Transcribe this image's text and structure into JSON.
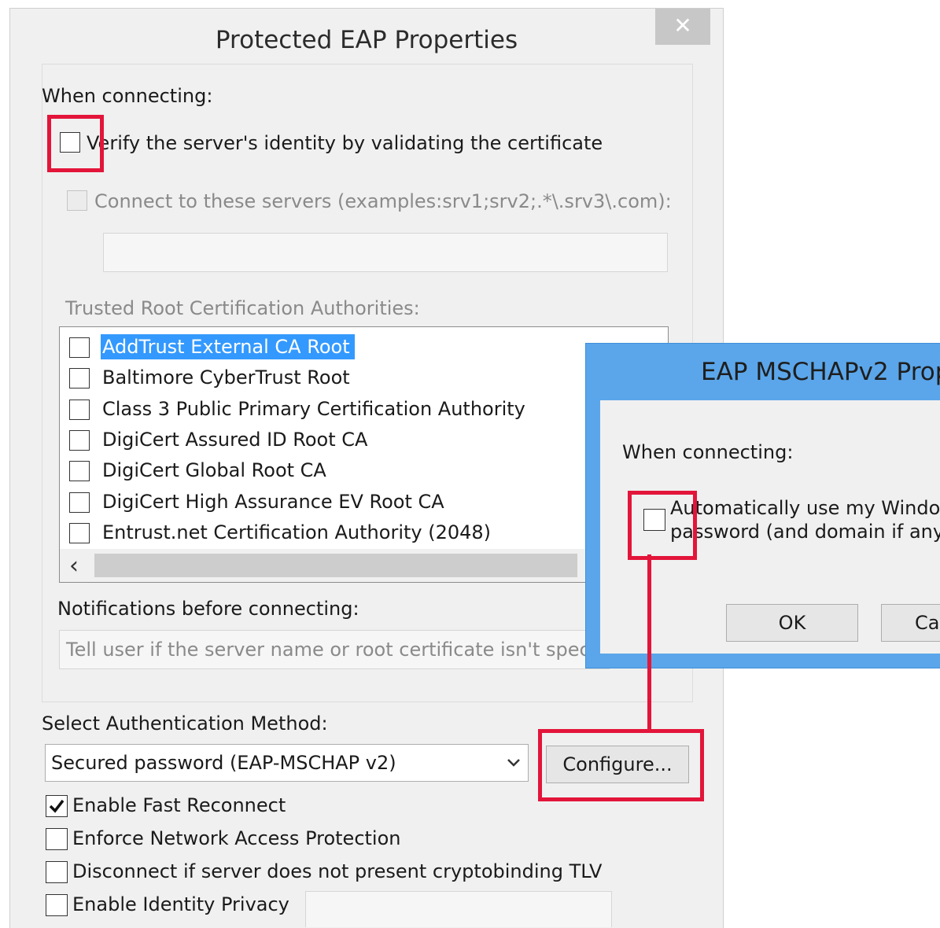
{
  "main_dialog": {
    "title": "Protected EAP Properties",
    "close_glyph": "✕",
    "when_connecting": "When connecting:",
    "verify_checkbox_label": "Verify the server's identity by validating the certificate",
    "verify_checked": false,
    "connect_servers_label": "Connect to these servers (examples:srv1;srv2;.*\\.srv3\\.com):",
    "connect_servers_value": "",
    "trusted_root_label": "Trusted Root Certification Authorities:",
    "trusted_roots": [
      {
        "label": "AddTrust External CA Root",
        "checked": false,
        "selected": true
      },
      {
        "label": "Baltimore CyberTrust Root",
        "checked": false,
        "selected": false
      },
      {
        "label": "Class 3 Public Primary Certification Authority",
        "checked": false,
        "selected": false
      },
      {
        "label": "DigiCert Assured ID Root CA",
        "checked": false,
        "selected": false
      },
      {
        "label": "DigiCert Global Root CA",
        "checked": false,
        "selected": false
      },
      {
        "label": "DigiCert High Assurance EV Root CA",
        "checked": false,
        "selected": false
      },
      {
        "label": "Entrust.net Certification Authority (2048)",
        "checked": false,
        "selected": false
      }
    ],
    "scroll_left_glyph": "‹",
    "notifications_label": "Notifications before connecting:",
    "notifications_value": "Tell user if the server name or root certificate isn't specified",
    "auth_method_label": "Select Authentication Method:",
    "auth_method_value": "Secured password (EAP-MSCHAP v2)",
    "configure_button": "Configure...",
    "options": [
      {
        "label": "Enable Fast Reconnect",
        "checked": true
      },
      {
        "label": "Enforce Network Access Protection",
        "checked": false
      },
      {
        "label": "Disconnect if server does not present cryptobinding TLV",
        "checked": false
      },
      {
        "label": "Enable Identity Privacy",
        "checked": false
      }
    ],
    "identity_privacy_value": ""
  },
  "mschap_dialog": {
    "title": "EAP MSCHAPv2 Prop",
    "when_connecting": "When connecting:",
    "auto_line1": "Automatically use my Windows l",
    "auto_line2": "password (and domain if any).",
    "auto_checked": false,
    "ok_button": "OK",
    "cancel_button": "Ca"
  },
  "colors": {
    "highlight": "#e3153a",
    "selection": "#3399ff",
    "dialog2_frame": "#5ba6ea"
  }
}
